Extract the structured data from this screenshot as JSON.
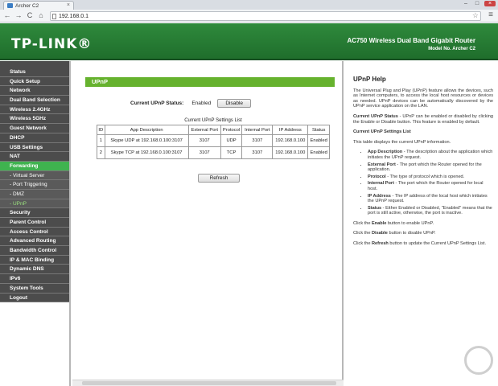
{
  "browser": {
    "tab_title": "Archer C2",
    "tab_close": "×",
    "url": "192.168.0.1",
    "window_buttons": [
      "–",
      "□",
      "×"
    ],
    "nav": {
      "back": "←",
      "forward": "→",
      "reload": "C",
      "home": "⌂"
    },
    "star": "☆",
    "menu": "≡"
  },
  "header": {
    "logo": "TP-LINK®",
    "model_title": "AC750 Wireless Dual Band Gigabit Router",
    "model_no": "Model No. Archer C2"
  },
  "sidebar": {
    "items": [
      {
        "label": "Status",
        "kind": "main"
      },
      {
        "label": "Quick Setup",
        "kind": "main"
      },
      {
        "label": "Network",
        "kind": "main"
      },
      {
        "label": "Dual Band Selection",
        "kind": "main"
      },
      {
        "label": "Wireless 2.4GHz",
        "kind": "main"
      },
      {
        "label": "Wireless 5GHz",
        "kind": "main"
      },
      {
        "label": "Guest Network",
        "kind": "main"
      },
      {
        "label": "DHCP",
        "kind": "main"
      },
      {
        "label": "USB Settings",
        "kind": "main"
      },
      {
        "label": "NAT",
        "kind": "main"
      },
      {
        "label": "Forwarding",
        "kind": "active"
      },
      {
        "label": "- Virtual Server",
        "kind": "sub"
      },
      {
        "label": "- Port Triggering",
        "kind": "sub"
      },
      {
        "label": "- DMZ",
        "kind": "sub"
      },
      {
        "label": "- UPnP",
        "kind": "subactive"
      },
      {
        "label": "Security",
        "kind": "main"
      },
      {
        "label": "Parent Control",
        "kind": "main"
      },
      {
        "label": "Access Control",
        "kind": "main"
      },
      {
        "label": "Advanced Routing",
        "kind": "main"
      },
      {
        "label": "Bandwidth Control",
        "kind": "main"
      },
      {
        "label": "IP & MAC Binding",
        "kind": "main"
      },
      {
        "label": "Dynamic DNS",
        "kind": "main"
      },
      {
        "label": "IPv6",
        "kind": "main"
      },
      {
        "label": "System Tools",
        "kind": "main"
      },
      {
        "label": "Logout",
        "kind": "main"
      }
    ]
  },
  "main": {
    "section_title": "UPnP",
    "status_label": "Current UPnP Status:",
    "status_value": "Enabled",
    "disable_button": "Disable",
    "table_title": "Current UPnP Settings List",
    "columns": [
      "ID",
      "App Description",
      "External Port",
      "Protocol",
      "Internal Port",
      "IP Address",
      "Status"
    ],
    "rows": [
      [
        "1",
        "Skype UDP at 192.168.0.100:3107",
        "3107",
        "UDP",
        "3107",
        "192.168.0.100",
        "Enabled"
      ],
      [
        "2",
        "Skype TCP at 192.168.0.100:3107",
        "3107",
        "TCP",
        "3107",
        "192.168.0.100",
        "Enabled"
      ]
    ],
    "refresh_button": "Refresh"
  },
  "help": {
    "title": "UPnP Help",
    "intro": "The Universal Plug and Play (UPnP) feature allows the devices, such as Internet computers, to access the local host resources or devices as needed. UPnP devices can be automatically discovered by the UPnP service application on the LAN.",
    "status_term": "Current UPnP Status",
    "status_text": " - UPnP can be enabled or disabled by clicking the Enable or Disable button. This feature is enabled by default.",
    "list_heading": "Current UPnP Settings List",
    "list_intro": "This table displays the current UPnP information.",
    "bullets": [
      {
        "term": "App Description",
        "text": " - The description about the application which initiates the UPnP request."
      },
      {
        "term": "External Port",
        "text": " - The port which the Router opened for the application."
      },
      {
        "term": "Protocol",
        "text": " - The type of protocol which is opened."
      },
      {
        "term": "Internal Port",
        "text": " - The port which the Router opened for local host."
      },
      {
        "term": "IP Address",
        "text": " - The IP address of the local host which initiates the UPnP request."
      },
      {
        "term": "Status",
        "text": " - Either Enabled or Disabled, \"Enabled\" means that the port is still active, otherwise, the port is inactive."
      }
    ],
    "enable_pre": "Click the ",
    "enable_term": "Enable",
    "enable_post": " button to enable UPnP.",
    "disable_pre": "Click the ",
    "disable_term": "Disable",
    "disable_post": " button to disable UPnP.",
    "refresh_pre": "Click the ",
    "refresh_term": "Refresh",
    "refresh_post": " button to update the Current UPnP Settings List."
  }
}
